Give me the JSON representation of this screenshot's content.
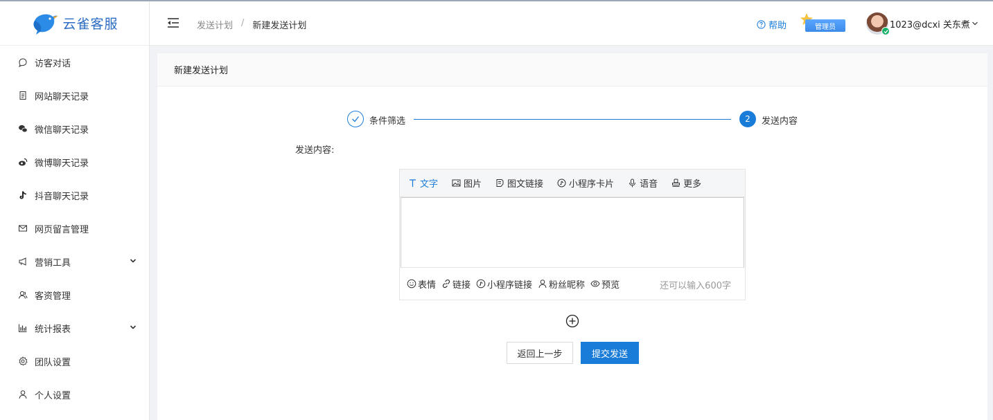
{
  "brand": {
    "name": "云雀客服",
    "color": "#2b6cc4"
  },
  "sidebar": {
    "items": [
      {
        "label": "访客对话",
        "icon": "chat-bubble-icon"
      },
      {
        "label": "网站聊天记录",
        "icon": "document-icon"
      },
      {
        "label": "微信聊天记录",
        "icon": "wechat-icon"
      },
      {
        "label": "微博聊天记录",
        "icon": "weibo-icon"
      },
      {
        "label": "抖音聊天记录",
        "icon": "tiktok-icon"
      },
      {
        "label": "网页留言管理",
        "icon": "mail-icon"
      },
      {
        "label": "营销工具",
        "icon": "megaphone-icon",
        "expandable": true
      },
      {
        "label": "客资管理",
        "icon": "users-icon"
      },
      {
        "label": "统计报表",
        "icon": "bar-chart-icon",
        "expandable": true
      },
      {
        "label": "团队设置",
        "icon": "gear-icon"
      },
      {
        "label": "个人设置",
        "icon": "user-icon"
      }
    ]
  },
  "header": {
    "breadcrumb": [
      "发送计划",
      "新建发送计划"
    ],
    "breadcrumb_sep": "/",
    "help_label": "帮助",
    "role_badge": "管理员",
    "username": "1023@dcxi 关东煮"
  },
  "page": {
    "title": "新建发送计划",
    "steps": [
      {
        "label": "条件筛选",
        "status": "done"
      },
      {
        "number": "2",
        "label": "发送内容",
        "status": "active"
      }
    ],
    "field_label": "发送内容:",
    "editor": {
      "tabs": [
        {
          "label": "文字",
          "icon": "text-icon",
          "active": true
        },
        {
          "label": "图片",
          "icon": "image-icon"
        },
        {
          "label": "图文链接",
          "icon": "article-link-icon"
        },
        {
          "label": "小程序卡片",
          "icon": "mini-program-icon"
        },
        {
          "label": "语音",
          "icon": "microphone-icon"
        },
        {
          "label": "更多",
          "icon": "stamp-icon"
        }
      ],
      "text_value": "",
      "tools": [
        {
          "label": "表情",
          "icon": "smile-icon"
        },
        {
          "label": "链接",
          "icon": "link-icon"
        },
        {
          "label": "小程序链接",
          "icon": "mini-program-icon"
        },
        {
          "label": "粉丝昵称",
          "icon": "user-icon"
        },
        {
          "label": "预览",
          "icon": "eye-icon"
        }
      ],
      "counter": "还可以输入600字"
    },
    "buttons": {
      "back": "返回上一步",
      "submit": "提交发送"
    }
  },
  "colors": {
    "accent": "#1a7cd9",
    "success": "#17b26a"
  }
}
